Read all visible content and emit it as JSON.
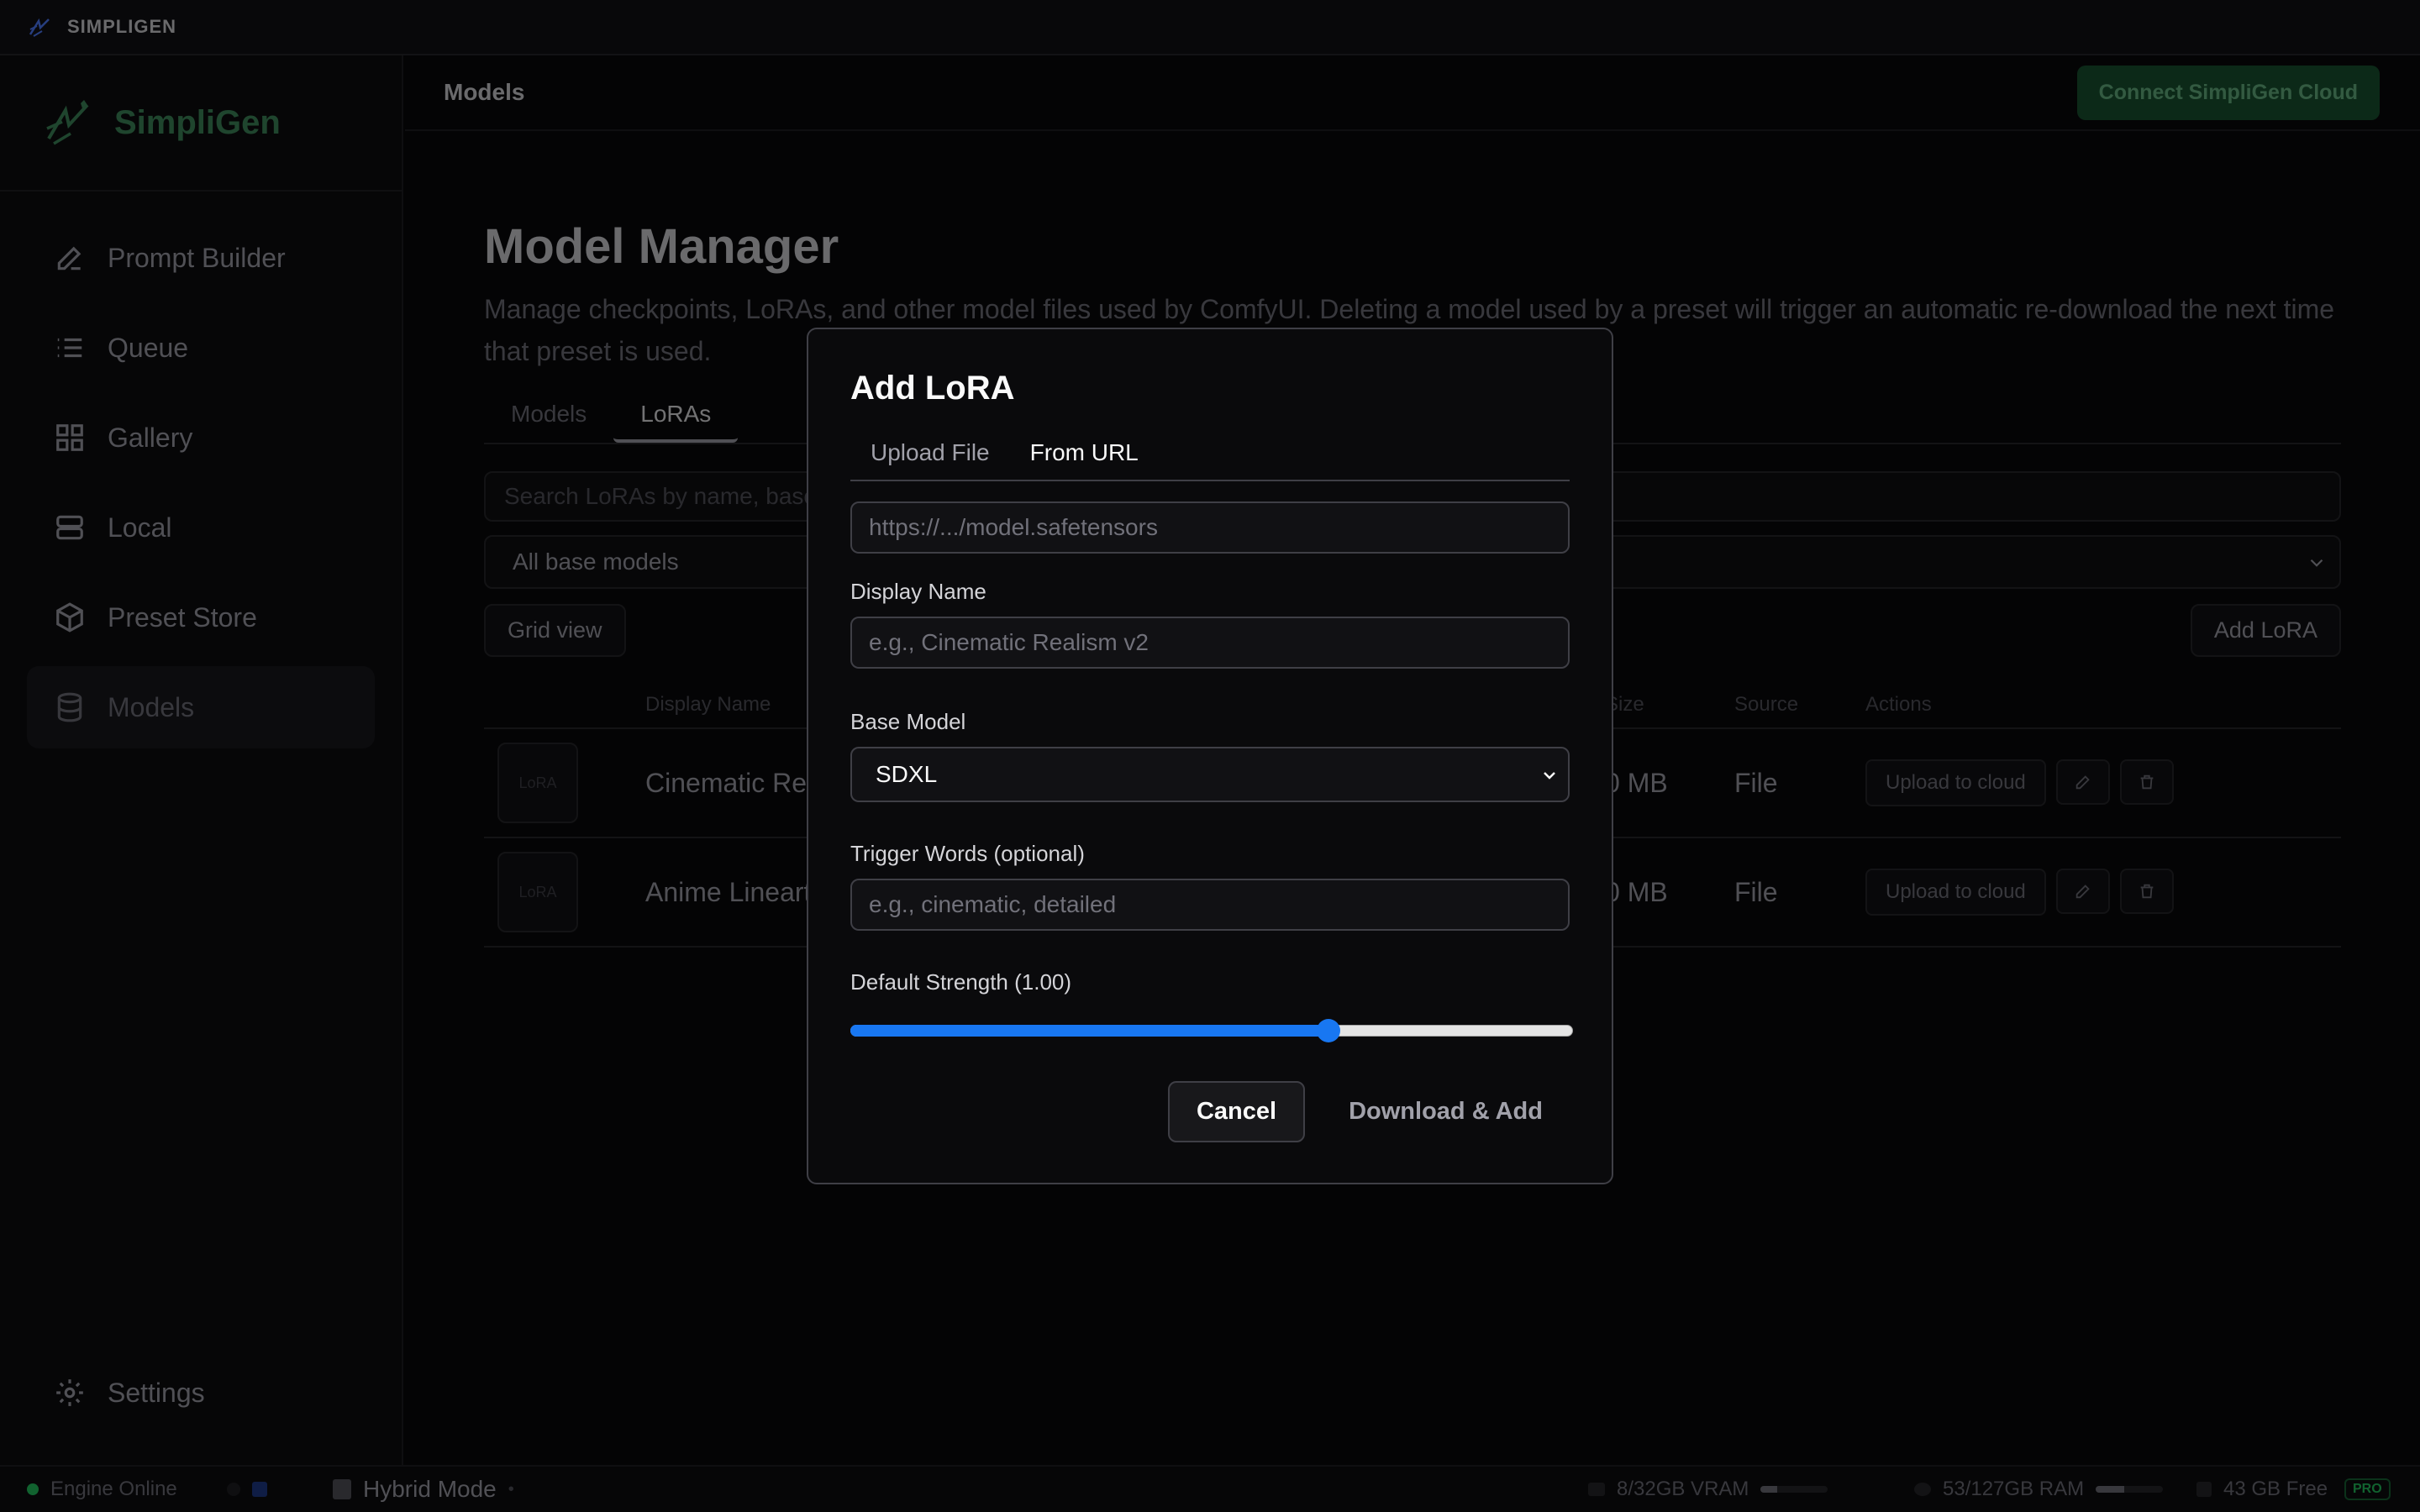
{
  "app": {
    "title": "SIMPLIGEN",
    "brand": "SimpliGen"
  },
  "sidebar": {
    "items": [
      {
        "label": "Prompt Builder",
        "icon": "pencil-icon"
      },
      {
        "label": "Queue",
        "icon": "list-icon"
      },
      {
        "label": "Gallery",
        "icon": "grid-icon"
      },
      {
        "label": "Local",
        "icon": "server-icon"
      },
      {
        "label": "Preset Store",
        "icon": "box-icon"
      },
      {
        "label": "Models",
        "icon": "database-icon",
        "active": true
      }
    ],
    "settings_label": "Settings"
  },
  "topbar": {
    "breadcrumb": "Models",
    "cloud_button": "Connect SimpliGen Cloud"
  },
  "page": {
    "title": "Model Manager",
    "description": "Manage checkpoints, LoRAs, and other model files used by ComfyUI. Deleting a model used by a preset will trigger an automatic re-download the next time that preset is used.",
    "tabs": [
      "Models",
      "LoRAs"
    ],
    "active_tab": "LoRAs",
    "search_placeholder": "Search LoRAs by name, base model, or trigger words...",
    "filter_value": "All base models",
    "grid_view_label": "Grid view",
    "add_lora_label": "Add LoRA"
  },
  "table": {
    "headers": {
      "display_name": "Display Name",
      "size": "Size",
      "source": "Source",
      "actions": "Actions"
    },
    "rows": [
      {
        "thumb": "LoRA",
        "name": "Cinematic Realism v2",
        "size": "0 MB",
        "source": "File"
      },
      {
        "thumb": "LoRA",
        "name": "Anime Lineart",
        "size": "0 MB",
        "source": "File"
      }
    ],
    "upload_label": "Upload to cloud"
  },
  "modal": {
    "title": "Add LoRA",
    "tabs": [
      "Upload File",
      "From URL"
    ],
    "active_tab": "From URL",
    "url_placeholder": "https://.../model.safetensors",
    "display_name_label": "Display Name",
    "display_name_placeholder": "e.g., Cinematic Realism v2",
    "base_model_label": "Base Model",
    "base_model_value": "SDXL",
    "trigger_label": "Trigger Words (optional)",
    "trigger_placeholder": "e.g., cinematic, detailed",
    "strength_label": "Default Strength (1.00)",
    "strength_fraction": 0.662,
    "cancel_label": "Cancel",
    "submit_label": "Download & Add"
  },
  "statusbar": {
    "engine": "Engine Online",
    "mode": "Hybrid Mode",
    "vram": "8/32GB VRAM",
    "vram_fraction": 0.25,
    "ram": "53/127GB RAM",
    "ram_fraction": 0.42,
    "disk": "43 GB Free",
    "badge": "PRO"
  },
  "colors": {
    "accent": "#1877f2",
    "brand": "#3f8a5c",
    "cloud_button": "#1f6b3e",
    "status_ok": "#22c55e"
  }
}
